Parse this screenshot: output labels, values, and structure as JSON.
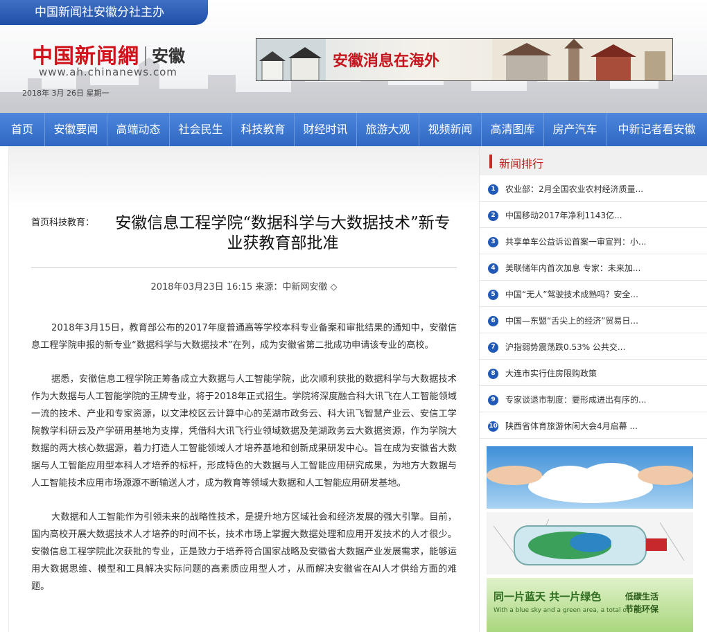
{
  "header": {
    "top_tab": "中国新闻社安徽分社主办",
    "logo_brand": "中国新闻網",
    "logo_region": "安徽",
    "logo_url": "www.ah.chinanews.com",
    "date": "2018年 3月 26日   星期一",
    "banner_text": "安徽消息在海外"
  },
  "nav": {
    "items": [
      {
        "label": "首页"
      },
      {
        "label": "安徽要闻"
      },
      {
        "label": "高端动态"
      },
      {
        "label": "社会民生"
      },
      {
        "label": "科技教育"
      },
      {
        "label": "财经时讯"
      },
      {
        "label": "旅游大观"
      },
      {
        "label": "视频新闻"
      },
      {
        "label": "高清图库"
      },
      {
        "label": "房产汽车"
      },
      {
        "label": "中新记者看安徽"
      }
    ]
  },
  "article": {
    "breadcrumb": "首页科技教育：",
    "title": "安徽信息工程学院“数据科学与大数据技术”新专业获教育部批准",
    "meta": "2018年03月23日  16:15    来源：中新网安徽  ◇",
    "paragraphs": [
      "2018年3月15日，教育部公布的2017年度普通高等学校本科专业备案和审批结果的通知中，安徽信息工程学院申报的新专业“数据科学与大数据技术”在列，成为安徽省第二批成功申请该专业的高校。",
      "据悉，安徽信息工程学院正筹备成立大数据与人工智能学院，此次顺利获批的数据科学与大数据技术作为大数据与人工智能学院的王牌专业，将于2018年正式招生。学院将深度融合科大讯飞在人工智能领域一流的技术、产业和专家资源，以文津校区云计算中心的芜湖市政务云、科大讯飞智慧产业云、安信工学院教学科研云及产学研用基地为支撑，凭借科大讯飞行业领域数据及芜湖政务云大数据资源，作为学院大数据的两大核心数据源，着力打造人工智能领域人才培养基地和创新成果研发中心。旨在成为安徽省大数据与人工智能应用型本科人才培养的标杆，形成特色的大数据与人工智能应用研究成果，为地方大数据与人工智能技术应用市场源源不断输送人才，成为教育等领域大数据和人工智能应用研发基地。",
      "大数据和人工智能作为引领未来的战略性技术，是提升地方区域社会和经济发展的强大引擎。目前，国内高校开展大数据技术人才培养的时间不长，技术市场上掌握大数据处理和应用开发技术的人才很少。安徽信息工程学院此次获批的专业，正是致力于培养符合国家战略及安徽省大数据产业发展需求，能够运用大数据思维、模型和工具解决实际问题的高素质应用型人才，从而解决安徽省在AI人才供给方面的难题。"
    ]
  },
  "sidebar": {
    "rank_title": "新闻排行",
    "rank_items": [
      {
        "num": "1",
        "text": "农业部：2月全国农业农村经济质量..."
      },
      {
        "num": "2",
        "text": "中国移动2017年净利1143亿..."
      },
      {
        "num": "3",
        "text": "共享单车公益诉讼首案一审宣判：小..."
      },
      {
        "num": "4",
        "text": "美联储年内首次加息 专家：未来加..."
      },
      {
        "num": "5",
        "text": "中国“无人”驾驶技术成熟吗？安全..."
      },
      {
        "num": "6",
        "text": "中国—东盟“舌尖上的经济”贸易日..."
      },
      {
        "num": "7",
        "text": "沪指弱势震荡跌0.53% 公共交..."
      },
      {
        "num": "8",
        "text": "大连市实行住房限购政策"
      },
      {
        "num": "9",
        "text": "专家谈退市制度：要形成进出有序的..."
      },
      {
        "num": "10",
        "text": "陕西省体育旅游休闲大会4月启幕 ..."
      }
    ],
    "ad3_text": "同一片蓝天 共一片绿色",
    "ad3_sub": "With a blue sky and a green area, a total of",
    "ad3_side_1": "低碳生活",
    "ad3_side_2": "节能环保"
  },
  "colors": {
    "nav_blue": "#3a74cf",
    "brand_red": "#d0121b",
    "rank_blue": "#2159b7"
  }
}
